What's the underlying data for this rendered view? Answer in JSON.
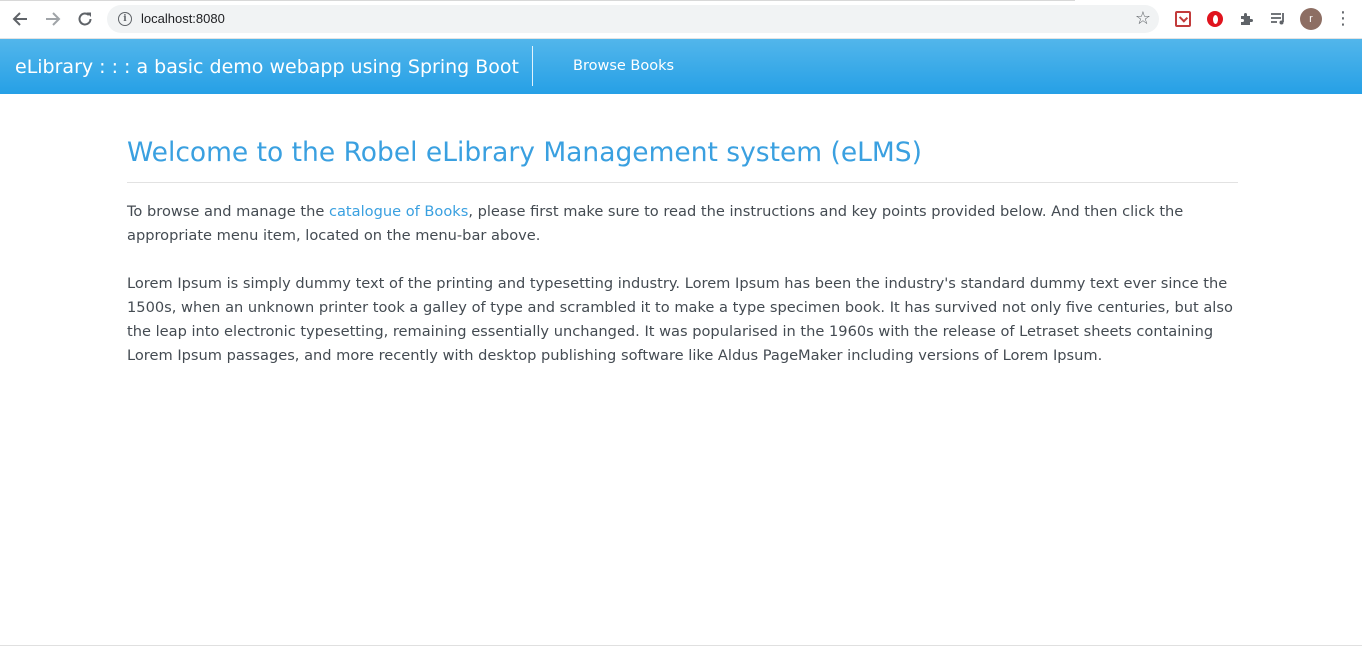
{
  "browser": {
    "url": "localhost:8080",
    "back_icon": "arrow-left-icon",
    "forward_icon": "arrow-right-icon",
    "reload_icon": "reload-icon",
    "avatar_initial": "r"
  },
  "navbar": {
    "brand": "eLibrary : : : a basic demo webapp using Spring Boot",
    "browse_link": "Browse Books",
    "gradient_top": "#52b6eb",
    "gradient_bottom": "#26a0e6"
  },
  "main": {
    "title": "Welcome to the Robel eLibrary Management system (eLMS)",
    "intro_before": "To browse and manage the ",
    "intro_link": "catalogue of Books",
    "intro_after": ", please first make sure to read the instructions and key points provided below. And then click the appropriate menu item, located on the menu-bar above.",
    "lorem": "Lorem Ipsum is simply dummy text of the printing and typesetting industry. Lorem Ipsum has been the industry's standard dummy text ever since the 1500s, when an unknown printer took a galley of type and scrambled it to make a type specimen book. It has survived not only five centuries, but also the leap into electronic typesetting, remaining essentially unchanged. It was popularised in the 1960s with the release of Letraset sheets containing Lorem Ipsum passages, and more recently with desktop publishing software like Aldus PageMaker including versions of Lorem Ipsum.",
    "accent_color": "#3aa0e0"
  }
}
